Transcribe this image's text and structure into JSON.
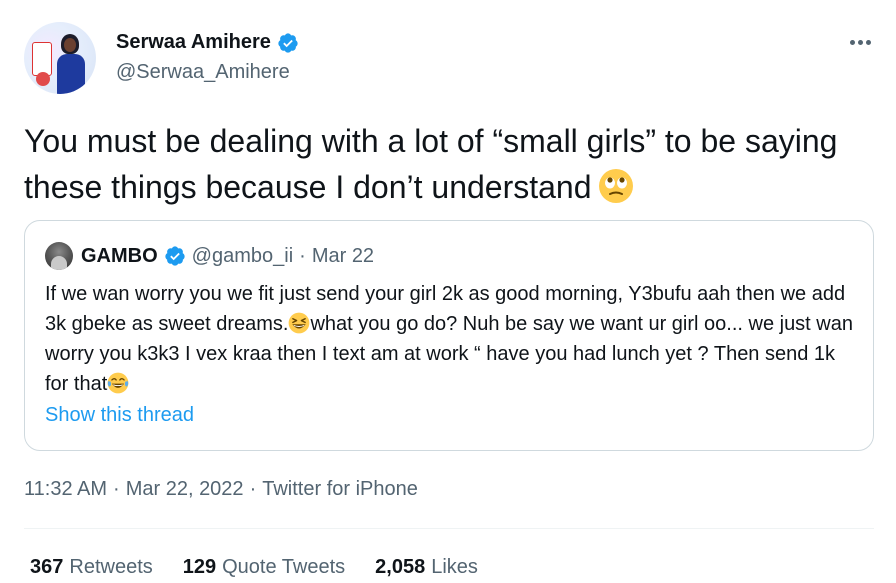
{
  "author": {
    "display_name": "Serwaa Amihere",
    "handle": "@Serwaa_Amihere",
    "verified": true
  },
  "tweet": {
    "text": "You must be dealing with a lot of “small girls” to be saying these things because I don’t understand",
    "trailing_emoji": "face-with-rolling-eyes"
  },
  "quoted_tweet": {
    "display_name": "GAMBO",
    "handle": "@gambo_ii",
    "separator": "·",
    "date": "Mar 22",
    "verified": true,
    "text_part1": "If we wan worry you we fit just send your girl 2k as good morning, Y3bufu aah then we add 3k gbeke as sweet dreams.",
    "emoji1": "grinning-squinting-face",
    "text_part2": "what you go do? Nuh be say we want ur girl oo... we just wan worry you k3k3 I vex kraa then I text am at work “ have you had lunch yet ? Then send 1k for that",
    "emoji2": "face-with-tears-of-joy",
    "show_thread_label": "Show this thread"
  },
  "meta": {
    "time": "11:32 AM",
    "sep1": "·",
    "date": "Mar 22, 2022",
    "sep2": "·",
    "source": "Twitter for iPhone"
  },
  "stats": {
    "retweets_count": "367",
    "retweets_label": "Retweets",
    "quotes_count": "129",
    "quotes_label": "Quote Tweets",
    "likes_count": "2,058",
    "likes_label": "Likes"
  },
  "colors": {
    "accent": "#1d9bf0",
    "secondary_text": "#536471",
    "border": "#cfd9de"
  }
}
